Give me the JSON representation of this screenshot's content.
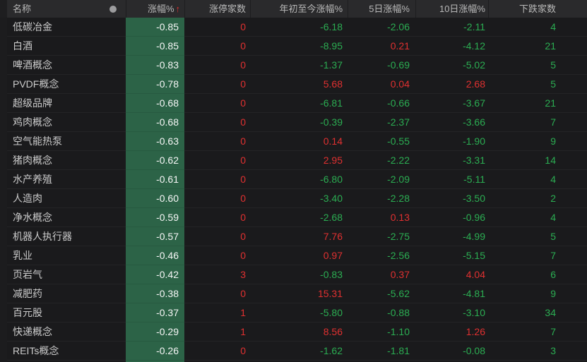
{
  "table": {
    "columns": {
      "name": "名称",
      "change": "涨幅%",
      "sort_arrow": "↑",
      "limit_up": "涨停家数",
      "ytd": "年初至今涨幅%",
      "d5": "5日涨幅%",
      "d10": "10日涨幅%",
      "decliners": "下跌家数"
    },
    "rows": [
      {
        "name": "低碳冶金",
        "change": "-0.85",
        "limit_up": "0",
        "ytd": "-6.18",
        "d5": "-2.06",
        "d10": "-2.11",
        "decliners": "4"
      },
      {
        "name": "白酒",
        "change": "-0.85",
        "limit_up": "0",
        "ytd": "-8.95",
        "d5": "0.21",
        "d10": "-4.12",
        "decliners": "21"
      },
      {
        "name": "啤酒概念",
        "change": "-0.83",
        "limit_up": "0",
        "ytd": "-1.37",
        "d5": "-0.69",
        "d10": "-5.02",
        "decliners": "5"
      },
      {
        "name": "PVDF概念",
        "change": "-0.78",
        "limit_up": "0",
        "ytd": "5.68",
        "d5": "0.04",
        "d10": "2.68",
        "decliners": "5"
      },
      {
        "name": "超级品牌",
        "change": "-0.68",
        "limit_up": "0",
        "ytd": "-6.81",
        "d5": "-0.66",
        "d10": "-3.67",
        "decliners": "21"
      },
      {
        "name": "鸡肉概念",
        "change": "-0.68",
        "limit_up": "0",
        "ytd": "-0.39",
        "d5": "-2.37",
        "d10": "-3.66",
        "decliners": "7"
      },
      {
        "name": "空气能热泵",
        "change": "-0.63",
        "limit_up": "0",
        "ytd": "0.14",
        "d5": "-0.55",
        "d10": "-1.90",
        "decliners": "9"
      },
      {
        "name": "猪肉概念",
        "change": "-0.62",
        "limit_up": "0",
        "ytd": "2.95",
        "d5": "-2.22",
        "d10": "-3.31",
        "decliners": "14"
      },
      {
        "name": "水产养殖",
        "change": "-0.61",
        "limit_up": "0",
        "ytd": "-6.80",
        "d5": "-2.09",
        "d10": "-5.11",
        "decliners": "4"
      },
      {
        "name": "人造肉",
        "change": "-0.60",
        "limit_up": "0",
        "ytd": "-3.40",
        "d5": "-2.28",
        "d10": "-3.50",
        "decliners": "2"
      },
      {
        "name": "净水概念",
        "change": "-0.59",
        "limit_up": "0",
        "ytd": "-2.68",
        "d5": "0.13",
        "d10": "-0.96",
        "decliners": "4"
      },
      {
        "name": "机器人执行器",
        "change": "-0.57",
        "limit_up": "0",
        "ytd": "7.76",
        "d5": "-2.75",
        "d10": "-4.99",
        "decliners": "5"
      },
      {
        "name": "乳业",
        "change": "-0.46",
        "limit_up": "0",
        "ytd": "0.97",
        "d5": "-2.56",
        "d10": "-5.15",
        "decliners": "7"
      },
      {
        "name": "页岩气",
        "change": "-0.42",
        "limit_up": "3",
        "ytd": "-0.83",
        "d5": "0.37",
        "d10": "4.04",
        "decliners": "6"
      },
      {
        "name": "减肥药",
        "change": "-0.38",
        "limit_up": "0",
        "ytd": "15.31",
        "d5": "-5.62",
        "d10": "-4.81",
        "decliners": "9"
      },
      {
        "name": "百元股",
        "change": "-0.37",
        "limit_up": "1",
        "ytd": "-5.80",
        "d5": "-0.88",
        "d10": "-3.10",
        "decliners": "34"
      },
      {
        "name": "快递概念",
        "change": "-0.29",
        "limit_up": "1",
        "ytd": "8.56",
        "d5": "-1.10",
        "d10": "1.26",
        "decliners": "7"
      },
      {
        "name": "REITs概念",
        "change": "-0.26",
        "limit_up": "0",
        "ytd": "-1.62",
        "d5": "-1.81",
        "d10": "-0.08",
        "decliners": "3"
      }
    ]
  },
  "colors": {
    "up_red": "#e03030",
    "down_green": "#2bad52",
    "change_cell_bg": "#2c6347",
    "change_cell_text": "#f7f7f7",
    "header_bg": "#2a2a2c",
    "row_bg": "#1a1a1c"
  }
}
